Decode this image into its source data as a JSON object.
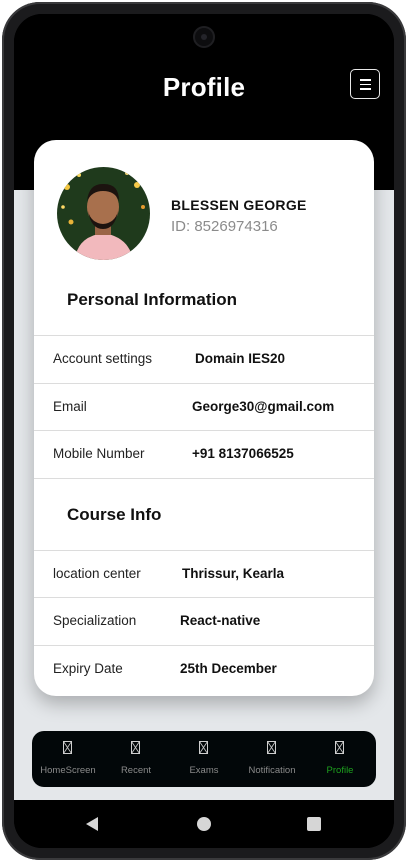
{
  "header": {
    "title": "Profile"
  },
  "profile": {
    "name": "BLESSEN GEORGE",
    "id_text": "ID: 8526974316"
  },
  "personal": {
    "title": "Personal Information",
    "rows": [
      {
        "label": "Account settings",
        "value": "Domain IES20"
      },
      {
        "label": "Email",
        "value": "George30@gmail.com"
      },
      {
        "label": "Mobile Number",
        "value": "+91 8137066525"
      }
    ]
  },
  "course": {
    "title": "Course Info",
    "rows": [
      {
        "label": "location center",
        "value": "Thrissur, Kearla"
      },
      {
        "label": "Specialization",
        "value": "React-native"
      },
      {
        "label": "Expiry Date",
        "value": "25th December"
      }
    ]
  },
  "tabs": [
    {
      "label": "HomeScreen",
      "icon": "broken-image-icon"
    },
    {
      "label": "Recent",
      "icon": "broken-image-icon"
    },
    {
      "label": "Exams",
      "icon": "broken-image-icon"
    },
    {
      "label": "Notification",
      "icon": "broken-image-icon"
    },
    {
      "label": "Profile",
      "icon": "broken-image-icon",
      "active": true
    }
  ],
  "colors": {
    "header_bg": "#000000",
    "content_bg": "#e4e7ea",
    "tab_active": "#1ea01e",
    "tab_inactive": "#8a8a8a"
  }
}
